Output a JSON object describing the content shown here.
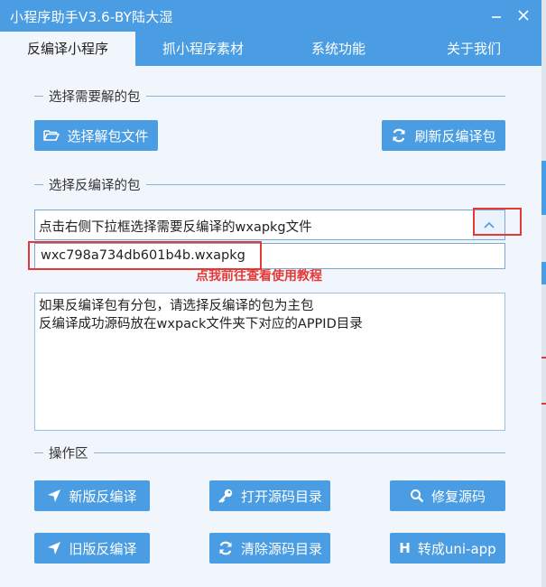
{
  "window": {
    "title": "小程序助手V3.6-BY陆大湿"
  },
  "tabs": [
    {
      "label": "反编译小程序",
      "active": true
    },
    {
      "label": "抓小程序素材",
      "active": false
    },
    {
      "label": "系统功能",
      "active": false
    },
    {
      "label": "关于我们",
      "active": false
    }
  ],
  "sections": {
    "select_unpack": "选择需要解的包",
    "select_decompile": "选择反编译的包",
    "operations": "操作区"
  },
  "buttons": {
    "choose_file": "选择解包文件",
    "refresh": "刷新反编译包",
    "new_decompile": "新版反编译",
    "open_source_dir": "打开源码目录",
    "repair_source": "修复源码",
    "old_decompile": "旧版反编译",
    "clear_source_dir": "清除源码目录",
    "to_uniapp": "转成uni-app"
  },
  "combo": {
    "text": "点击右侧下拉框选择需要反编译的wxapkg文件",
    "option": "wxc798a734db601b4b.wxapkg"
  },
  "help_link": "点我前往查看使用教程",
  "notes": [
    "如果反编译包有分包，请选择反编译的包为主包",
    "反编译成功源码放在wxpack文件夹下对应的APPID目录"
  ],
  "colors": {
    "accent": "#4a9de3",
    "highlight": "#e53935"
  }
}
